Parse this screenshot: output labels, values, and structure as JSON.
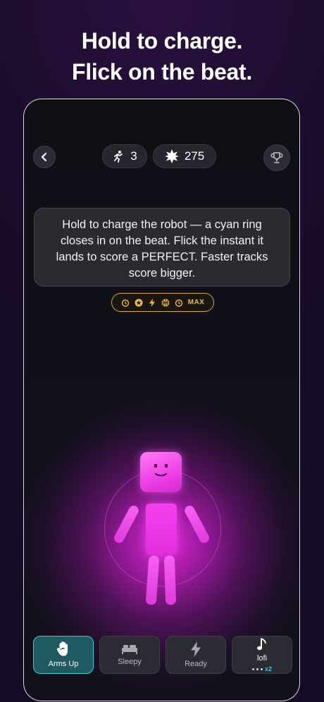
{
  "headline": {
    "line1": "Hold to charge.",
    "line2": "Flick on the beat."
  },
  "topbar": {
    "back_icon": "chevron-left-icon",
    "moves_icon": "running-figure-icon",
    "moves_count": "3",
    "score_icon": "starburst-icon",
    "score_value": "275",
    "trophy_icon": "trophy-icon"
  },
  "tooltip": {
    "text": "Hold to charge the robot — a cyan ring closes in on the beat. Flick the instant it lands to score a PERFECT. Faster tracks score bigger."
  },
  "badges": {
    "icons": [
      "timer-icon",
      "star-coin-icon",
      "lightning-icon",
      "basketball-icon",
      "timer-icon"
    ],
    "max_label": "MAX",
    "accent": "#e9b944"
  },
  "tabs": [
    {
      "icon": "hand-icon",
      "label": "Arms Up",
      "active": true
    },
    {
      "icon": "bed-icon",
      "label": "Sleepy",
      "active": false
    },
    {
      "icon": "lightning-icon",
      "label": "Ready",
      "active": false
    },
    {
      "icon": "music-note-icon",
      "label": "lofi",
      "active": false,
      "multiplier": "x2"
    }
  ],
  "colors": {
    "robot": "#ee3fe6",
    "active_tab": "#38c8d8",
    "badge_gold": "#d9a93a"
  }
}
